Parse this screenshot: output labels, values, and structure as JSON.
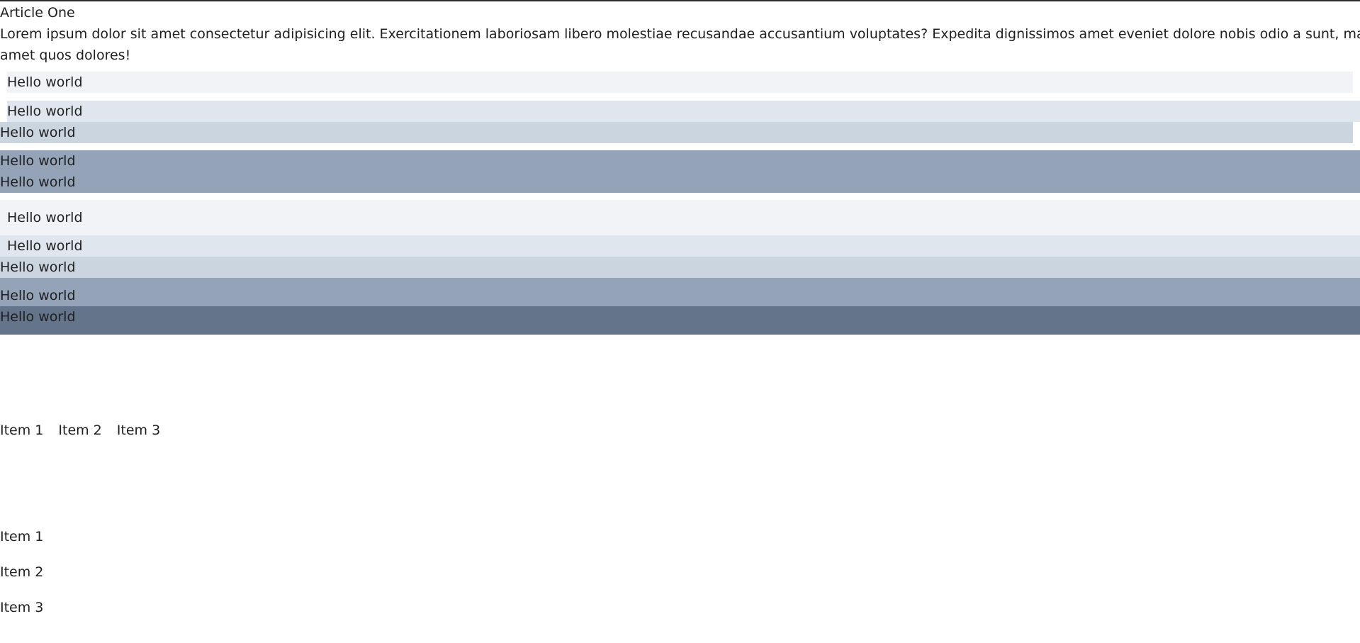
{
  "article": {
    "title": "Article One",
    "body_line1": "Lorem ipsum dolor sit amet consectetur adipisicing elit. Exercitationem laboriosam libero molestiae recusandae accusantium voluptates? Expedita dignissimos amet eveniet dolore nobis odio a sunt, maiores quasi. Modi",
    "body_line2": "amet quos dolores!"
  },
  "boxes": [
    {
      "text": "Hello world",
      "color": "#f1f3f7"
    },
    {
      "text": "Hello world",
      "color": "#e0e6ee"
    },
    {
      "text": "Hello world",
      "color": "#cbd5e0"
    },
    {
      "text": "Hello world",
      "color": "#94a3b8"
    },
    {
      "text": "Hello world",
      "color": "#94a3b8"
    },
    {
      "text": "Hello world",
      "color": "#f1f3f7"
    },
    {
      "text": "Hello world",
      "color": "#e0e6ee"
    },
    {
      "text": "Hello world",
      "color": "#cbd5e0"
    },
    {
      "text": "Hello world",
      "color": "#94a3b8"
    },
    {
      "text": "Hello world",
      "color": "#64748b"
    }
  ],
  "horizontal_list": [
    "Item 1",
    "Item 2",
    "Item 3"
  ],
  "vertical_list": [
    "Item 1",
    "Item 2",
    "Item 3"
  ]
}
